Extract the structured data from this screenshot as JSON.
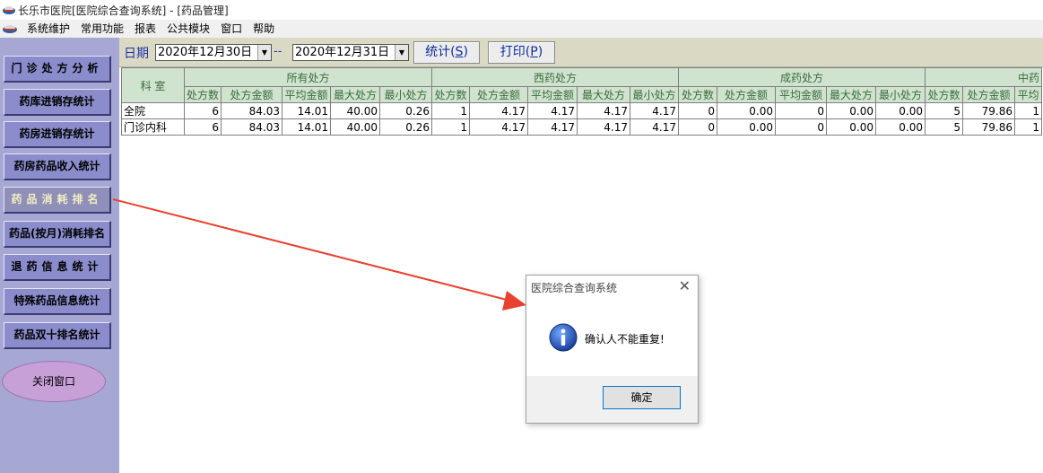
{
  "window": {
    "title": "长乐市医院[医院综合查询系统] - [药品管理]"
  },
  "menu": [
    "系统维护",
    "常用功能",
    "报表",
    "公共模块",
    "窗口",
    "帮助"
  ],
  "sidebar": {
    "items": [
      {
        "label": "门诊处方分析"
      },
      {
        "label": "药库进销存统计"
      },
      {
        "label": "药房进销存统计"
      },
      {
        "label": "药房药品收入统计"
      },
      {
        "label": "药品消耗排名"
      },
      {
        "label": "药品(按月)消耗排名"
      },
      {
        "label": "退药信息统计"
      },
      {
        "label": "特殊药品信息统计"
      },
      {
        "label": "药品双十排名统计"
      }
    ],
    "close_label": "关闭窗口"
  },
  "toolbar": {
    "date_label": "日期",
    "start_date": "2020年12月30日",
    "separator": "--",
    "end_date": "2020年12月31日",
    "stat_label": "统计",
    "stat_hotkey": "S",
    "print_label": "打印",
    "print_hotkey": "P"
  },
  "table": {
    "dept_header": "科 室",
    "groups": [
      "所有处方",
      "西药处方",
      "成药处方",
      "中药"
    ],
    "sub_headers": [
      "处方数",
      "处方金额",
      "平均金额",
      "最大处方",
      "最小处方",
      "处方数",
      "处方金额",
      "平均金额",
      "最大处方",
      "最小处方",
      "处方数",
      "处方金额",
      "平均金额",
      "最大处方",
      "最小处方",
      "处方数",
      "处方金额",
      "平均"
    ],
    "rows": [
      {
        "name": "全院",
        "cells": [
          "6",
          "84.03",
          "14.01",
          "40.00",
          "0.26",
          "1",
          "4.17",
          "4.17",
          "4.17",
          "4.17",
          "0",
          "0.00",
          "0",
          "0.00",
          "0.00",
          "5",
          "79.86",
          "1"
        ]
      },
      {
        "name": "门诊内科",
        "cells": [
          "6",
          "84.03",
          "14.01",
          "40.00",
          "0.26",
          "1",
          "4.17",
          "4.17",
          "4.17",
          "4.17",
          "0",
          "0.00",
          "0",
          "0.00",
          "0.00",
          "5",
          "79.86",
          "1"
        ]
      }
    ]
  },
  "dialog": {
    "title": "医院综合查询系统",
    "message": "确认人不能重复!",
    "ok_label": "确定"
  },
  "colors": {
    "sidebar_bg": "#a7a7d3",
    "sidebar_button": "#8a8ccc",
    "header_bg": "#cfe3cf",
    "arrow": "#e8412f",
    "toolbar_text": "#0b2d9c"
  }
}
